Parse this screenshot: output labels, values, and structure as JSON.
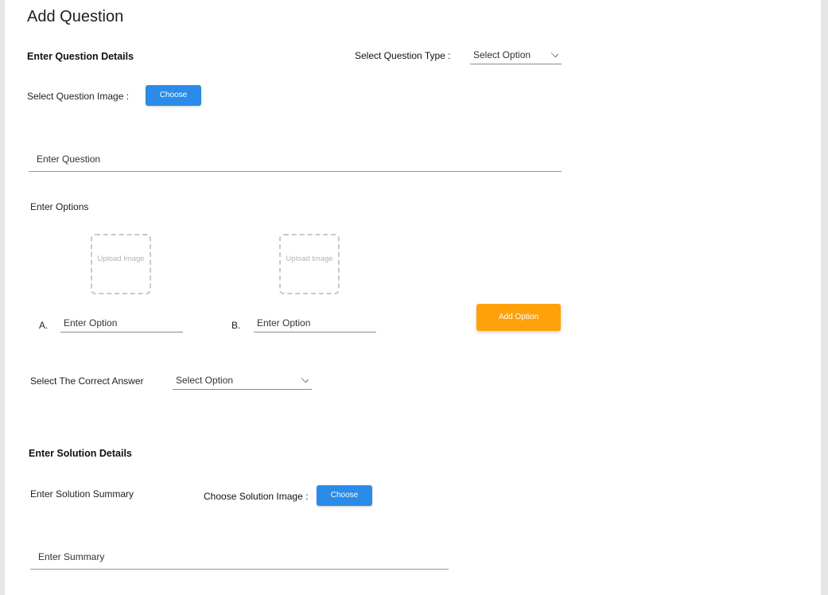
{
  "page": {
    "title": "Add Question"
  },
  "question_details": {
    "heading": "Enter Question Details",
    "type_label": "Select Question Type :",
    "type_select_value": "Select Option",
    "image_label": "Select Question Image :",
    "choose_button": "Choose",
    "question_placeholder": "Enter Question"
  },
  "options": {
    "heading": "Enter Options",
    "items": [
      {
        "letter": "A.",
        "upload_label": "Upload Image",
        "placeholder": "Enter Option"
      },
      {
        "letter": "B.",
        "upload_label": "Upload Image",
        "placeholder": "Enter Option"
      }
    ],
    "add_button": "Add Option",
    "correct_answer_label": "Select The Correct Answer",
    "correct_answer_value": "Select Option"
  },
  "solution": {
    "heading": "Enter Solution Details",
    "summary_label": "Enter Solution Summary",
    "image_label": "Choose Solution Image :",
    "choose_button": "Choose",
    "summary_placeholder": "Enter Summary"
  },
  "colors": {
    "primary_button": "#2a8be8",
    "accent_button": "#ffa10a",
    "background": "#e6e6e6"
  }
}
